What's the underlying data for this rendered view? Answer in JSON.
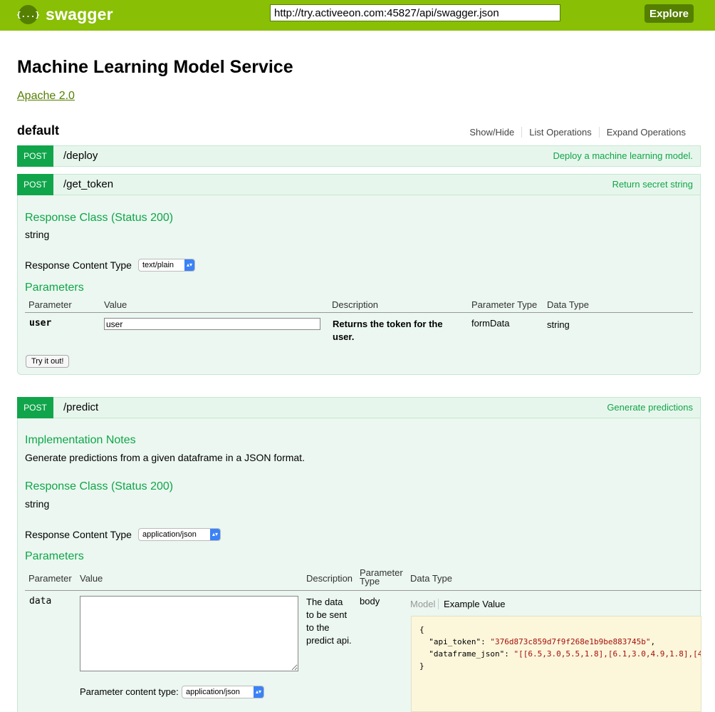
{
  "header": {
    "logo_glyph": "{...}",
    "logo_text": "swagger",
    "url_value": "http://try.activeeon.com:45827/api/swagger.json",
    "explore_label": "Explore",
    "colors": {
      "bar": "#89bf04",
      "dark": "#547f00"
    }
  },
  "info": {
    "title": "Machine Learning Model Service",
    "license": "Apache 2.0"
  },
  "resource": {
    "name": "default",
    "actions": [
      "Show/Hide",
      "List Operations",
      "Expand Operations"
    ]
  },
  "operations": [
    {
      "method": "POST",
      "path": "/deploy",
      "summary": "Deploy a machine learning model."
    },
    {
      "method": "POST",
      "path": "/get_token",
      "summary": "Return secret string",
      "response_class_heading": "Response Class (Status 200)",
      "response_class_value": "string",
      "content_type_label": "Response Content Type",
      "content_type_value": "text/plain",
      "parameters_heading": "Parameters",
      "param_headers": [
        "Parameter",
        "Value",
        "Description",
        "Parameter Type",
        "Data Type"
      ],
      "param": {
        "name": "user",
        "value": "user",
        "description": "Returns the token for the user.",
        "param_type": "formData",
        "data_type": "string"
      },
      "try_label": "Try it out!"
    },
    {
      "method": "POST",
      "path": "/predict",
      "summary": "Generate predictions",
      "impl_notes_heading": "Implementation Notes",
      "impl_notes": "Generate predictions from a given dataframe in a JSON format.",
      "response_class_heading": "Response Class (Status 200)",
      "response_class_value": "string",
      "content_type_label": "Response Content Type",
      "content_type_value": "application/json",
      "parameters_heading": "Parameters",
      "param_headers": [
        "Parameter",
        "Value",
        "Description",
        "Parameter Type",
        "Data Type"
      ],
      "param": {
        "name": "data",
        "value": "",
        "description": "The data to be sent to the predict api.",
        "param_type": "body",
        "param_content_type_label": "Parameter content type:",
        "param_content_type_value": "application/json",
        "model_tab": "Model",
        "example_tab": "Example Value",
        "example": {
          "open": "{",
          "api_token_key": "\"api_token\"",
          "api_token_val": "\"376d873c859d7f9f268e1b9be883745b\"",
          "dataframe_key": "\"dataframe_json\"",
          "dataframe_val": "\"[[6.5,3.0,5.5,1.8],[6.1,3.0,4.9,1.8],[4",
          "close": "}"
        }
      }
    }
  ]
}
